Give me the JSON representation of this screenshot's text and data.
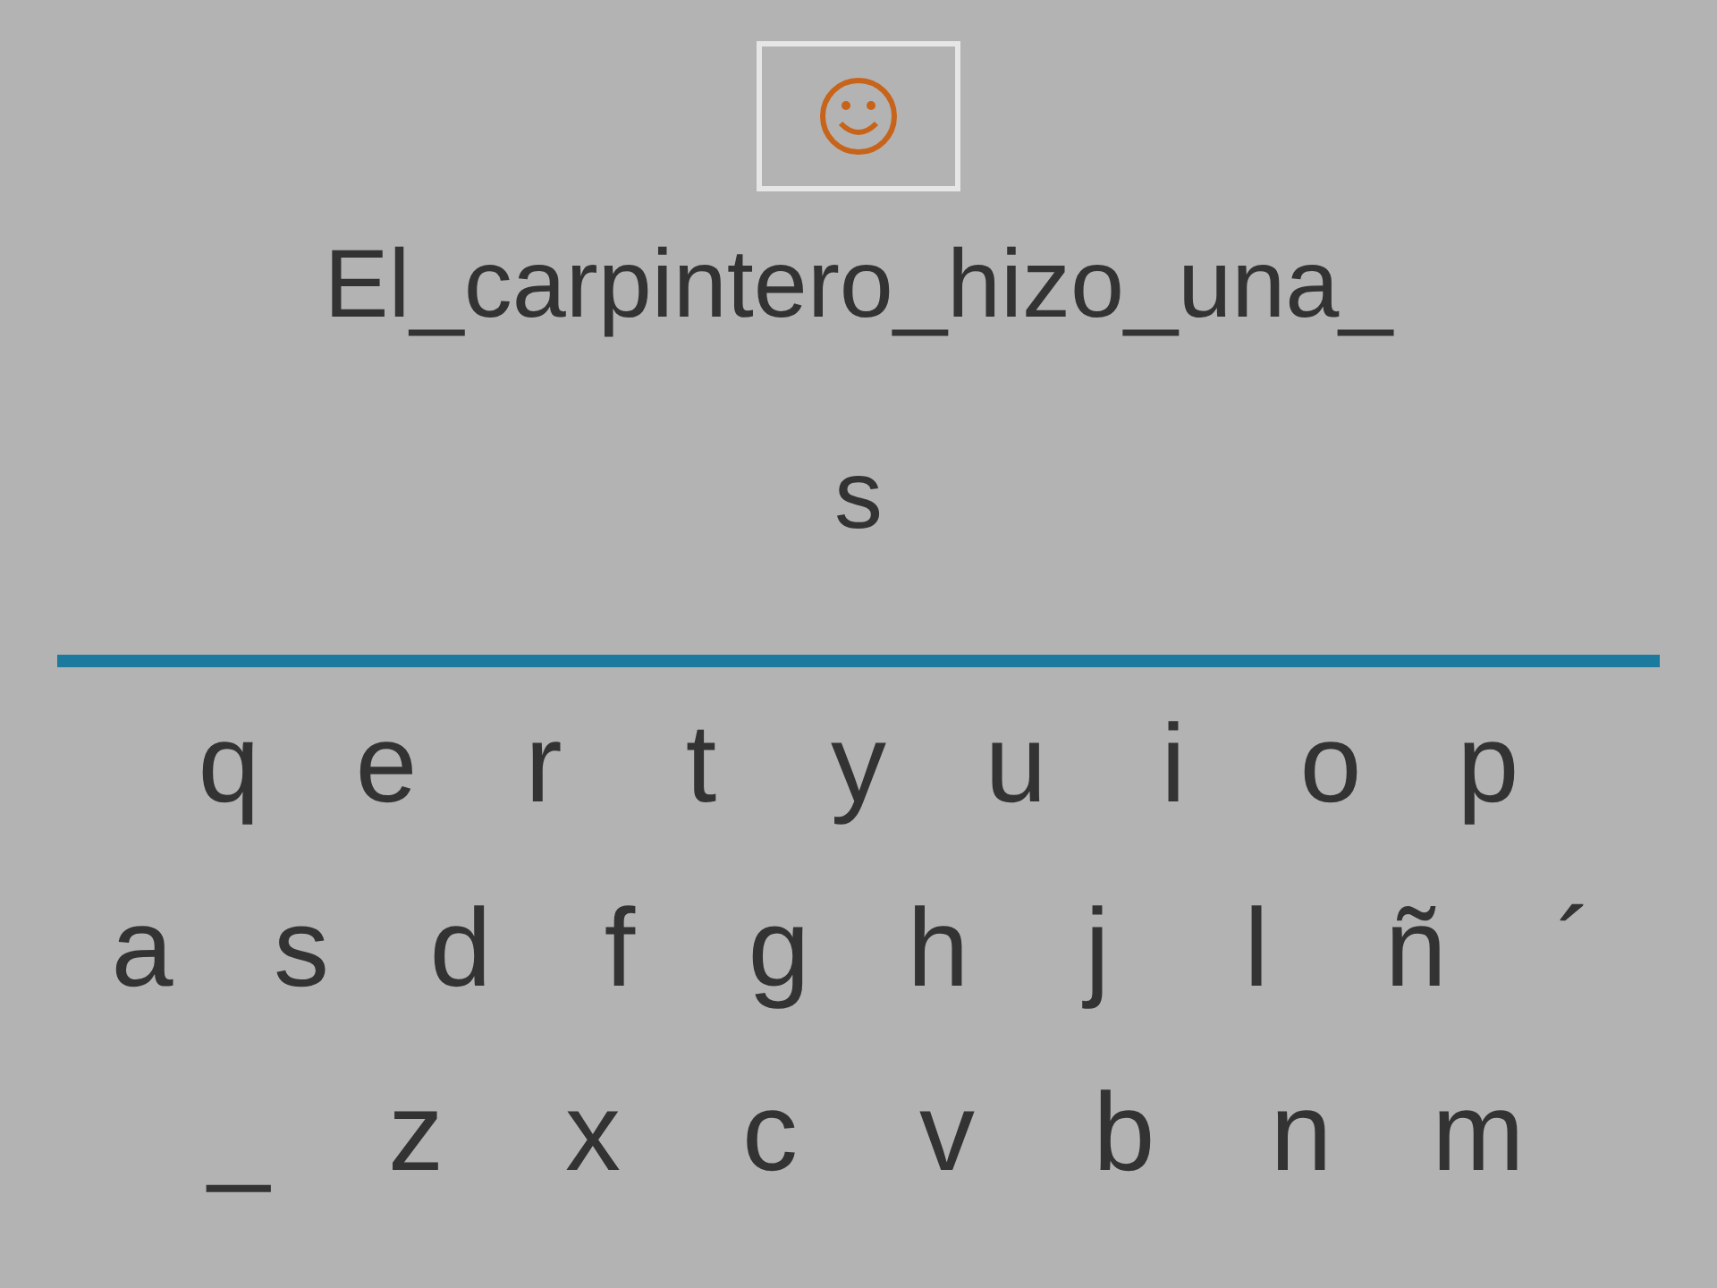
{
  "sentence": "El_carpintero_hizo_una_",
  "answer": "s",
  "keyboard": {
    "rows": [
      [
        "q",
        "e",
        "r",
        "t",
        "y",
        "u",
        "i",
        "o",
        "p"
      ],
      [
        "a",
        "s",
        "d",
        "f",
        "g",
        "h",
        "j",
        "l",
        "ñ",
        "´"
      ],
      [
        "_",
        "z",
        "x",
        "c",
        "v",
        "b",
        "n",
        "m"
      ]
    ]
  }
}
